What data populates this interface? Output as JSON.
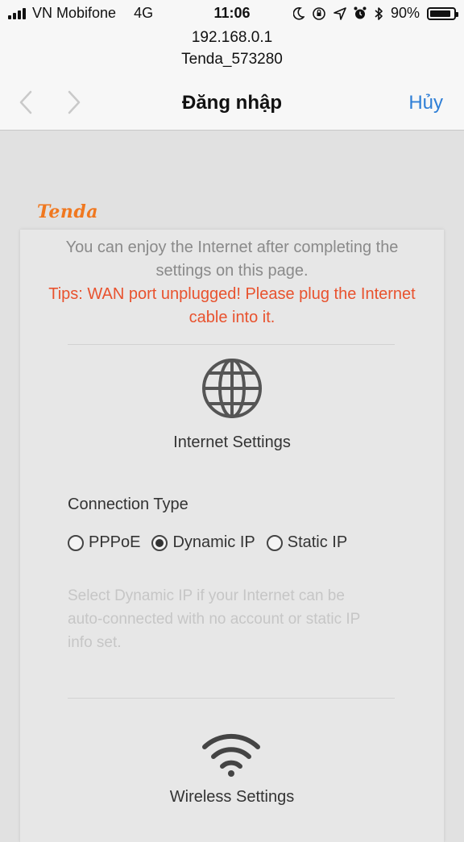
{
  "status_bar": {
    "carrier": "VN Mobifone",
    "network": "4G",
    "time": "11:06",
    "battery": "90%",
    "battery_level": 0.9,
    "icons": [
      "moon-icon",
      "orientation-lock-icon",
      "location-arrow-icon",
      "alarm-icon",
      "bluetooth-icon"
    ]
  },
  "header": {
    "url": "192.168.0.1",
    "network_name": "Tenda_573280",
    "title": "Đăng nhập",
    "cancel_label": "Hủy"
  },
  "brand": {
    "logo": "Tenda",
    "accent": "#f07820"
  },
  "page": {
    "intro": "You can enjoy the Internet after completing the settings on this page.",
    "tips": "Tips: WAN port unplugged! Please plug the Internet cable into it.",
    "internet_settings": "Internet Settings",
    "connection_type_label": "Connection Type",
    "connection_options": [
      {
        "label": "PPPoE",
        "selected": false
      },
      {
        "label": "Dynamic IP",
        "selected": true
      },
      {
        "label": "Static IP",
        "selected": false
      }
    ],
    "help_text": "Select Dynamic IP if your Internet can be auto-connected with no account or static IP info set.",
    "wireless_settings": "Wireless Settings"
  }
}
